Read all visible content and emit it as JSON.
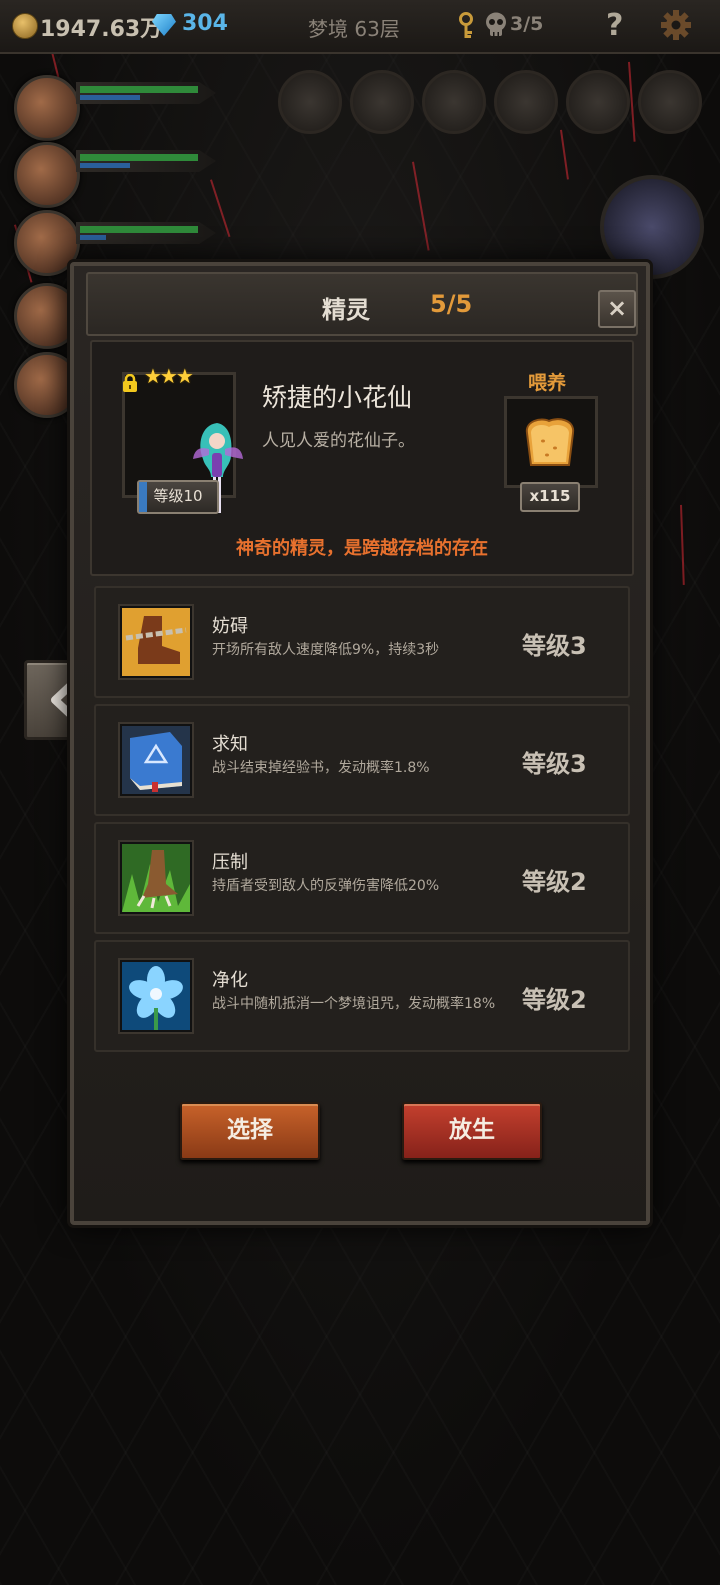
{
  "topbar": {
    "gold": "1947.63万",
    "gems": "304",
    "floor": "梦境 63层",
    "curses": "3/5",
    "help": "?"
  },
  "modal": {
    "title": "精灵",
    "count": "5/5",
    "close": "×",
    "fairy": {
      "stars": "★★★",
      "level": "等级10",
      "name": "矫捷的小花仙",
      "description": "人见人爱的花仙子。",
      "tagline": "神奇的精灵，是跨越存档的存在"
    },
    "feed": {
      "label": "喂养",
      "count": "x115"
    },
    "skills": [
      {
        "name": "妨碍",
        "description": "开场所有敌人速度降低9%，持续3秒",
        "level": "等级3",
        "icon": "chained-boot-icon"
      },
      {
        "name": "求知",
        "description": "战斗结束掉经验书，发动概率1.8%",
        "level": "等级3",
        "icon": "blue-book-icon"
      },
      {
        "name": "压制",
        "description": "持盾者受到敌人的反弹伤害降低20%",
        "level": "等级2",
        "icon": "claw-icon"
      },
      {
        "name": "净化",
        "description": "战斗中随机抵消一个梦境诅咒，发动概率18%",
        "level": "等级2",
        "icon": "blue-flower-icon"
      }
    ],
    "buttons": {
      "select": "选择",
      "release": "放生"
    }
  },
  "colors": {
    "accent_orange": "#e39a3a",
    "tagline": "#e8712e",
    "gem_blue": "#5ab5e8"
  }
}
